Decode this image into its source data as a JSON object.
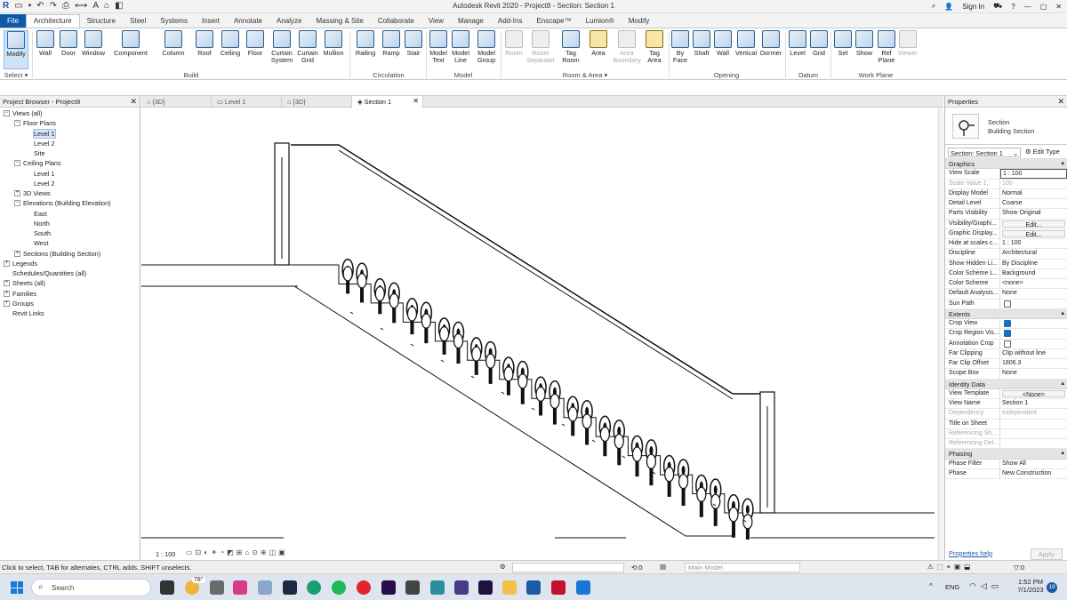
{
  "window": {
    "title": "Autodesk Revit 2020 - Project8 - Section: Section 1",
    "sign_in": "Sign In"
  },
  "ribbon_tabs": [
    "File",
    "Architecture",
    "Structure",
    "Steel",
    "Systems",
    "Insert",
    "Annotate",
    "Analyze",
    "Massing & Site",
    "Collaborate",
    "View",
    "Manage",
    "Add-Ins",
    "Enscape™",
    "Lumion®",
    "Modify"
  ],
  "ribbon": {
    "select_label": "Select",
    "modify": "Modify",
    "build": {
      "label": "Build",
      "buttons": [
        "Wall",
        "Door",
        "Window",
        "Component",
        "Column",
        "Roof",
        "Ceiling",
        "Floor",
        "Curtain System",
        "Curtain Grid",
        "Mullion"
      ]
    },
    "circulation": {
      "label": "Circulation",
      "buttons": [
        "Railing",
        "Ramp",
        "Stair"
      ]
    },
    "model": {
      "label": "Model",
      "buttons": [
        "Model Text",
        "Model Line",
        "Model Group"
      ]
    },
    "room_area": {
      "label": "Room & Area",
      "buttons": [
        "Room",
        "Room Separator",
        "Tag Room",
        "Area",
        "Area Boundary",
        "Tag Area"
      ]
    },
    "opening": {
      "label": "Opening",
      "buttons": [
        "By Face",
        "Shaft",
        "Wall",
        "Vertical",
        "Dormer"
      ]
    },
    "datum": {
      "label": "Datum",
      "buttons": [
        "Level",
        "Grid"
      ]
    },
    "work_plane": {
      "label": "Work Plane",
      "buttons": [
        "Set",
        "Show",
        "Ref Plane",
        "Viewer"
      ]
    }
  },
  "project_browser": {
    "title": "Project Browser - Project8",
    "nodes": [
      "Views (all)",
      "Floor Plans",
      "Level 1",
      "Level 2",
      "Site",
      "Ceiling Plans",
      "Level 1",
      "Level 2",
      "3D Views",
      "Elevations (Building Elevation)",
      "East",
      "North",
      "South",
      "West",
      "Sections (Building Section)",
      "Legends",
      "Schedules/Quantities (all)",
      "Sheets (all)",
      "Families",
      "Groups",
      "Revit Links"
    ]
  },
  "view_tabs": [
    "{3D}",
    "Level 1",
    "{3D}",
    "Section 1"
  ],
  "view_bar": {
    "scale": "1 : 100"
  },
  "properties": {
    "title": "Properties",
    "type_name": "Section",
    "type_sub": "Building Section",
    "selector": "Section: Section 1",
    "edit_type": "Edit Type",
    "categories": {
      "graphics": "Graphics",
      "extents": "Extents",
      "identity": "Identity Data",
      "phasing": "Phasing"
    },
    "graphics_rows": [
      [
        "View Scale",
        "1 : 100"
      ],
      [
        "Scale Value    1:",
        "100"
      ],
      [
        "Display Model",
        "Normal"
      ],
      [
        "Detail Level",
        "Coarse"
      ],
      [
        "Parts Visibility",
        "Show Original"
      ],
      [
        "Visibility/Graphi...",
        "Edit..."
      ],
      [
        "Graphic Display...",
        "Edit..."
      ],
      [
        "Hide at scales c...",
        "1 : 100"
      ],
      [
        "Discipline",
        "Architectural"
      ],
      [
        "Show Hidden Li...",
        "By Discipline"
      ],
      [
        "Color Scheme L...",
        "Background"
      ],
      [
        "Color Scheme",
        "<none>"
      ],
      [
        "Default Analysis...",
        "None"
      ],
      [
        "Sun Path",
        ""
      ]
    ],
    "extents_rows": [
      [
        "Crop View",
        ""
      ],
      [
        "Crop Region Vis...",
        ""
      ],
      [
        "Annotation Crop",
        ""
      ],
      [
        "Far Clipping",
        "Clip without line"
      ],
      [
        "Far Clip Offset",
        "1806.3"
      ],
      [
        "Scope Box",
        "None"
      ]
    ],
    "identity_rows": [
      [
        "View Template",
        "<None>"
      ],
      [
        "View Name",
        "Section 1"
      ],
      [
        "Dependency",
        "Independent"
      ],
      [
        "Title on Sheet",
        ""
      ],
      [
        "Referencing Sh...",
        ""
      ],
      [
        "Referencing Det...",
        ""
      ]
    ],
    "phasing_rows": [
      [
        "Phase Filter",
        "Show All"
      ],
      [
        "Phase",
        "New Construction"
      ]
    ],
    "help": "Properties help",
    "apply": "Apply"
  },
  "status": {
    "hint": "Click to select, TAB for alternates, CTRL adds, SHIFT unselects.",
    "workset_count": ":0",
    "model": "Main Model",
    "filter_count": ":0"
  },
  "taskbar": {
    "search": "Search",
    "weather": "78°",
    "lang": "ENG",
    "time": "1:52 PM",
    "date": "7/1/2023",
    "badge": "19"
  }
}
